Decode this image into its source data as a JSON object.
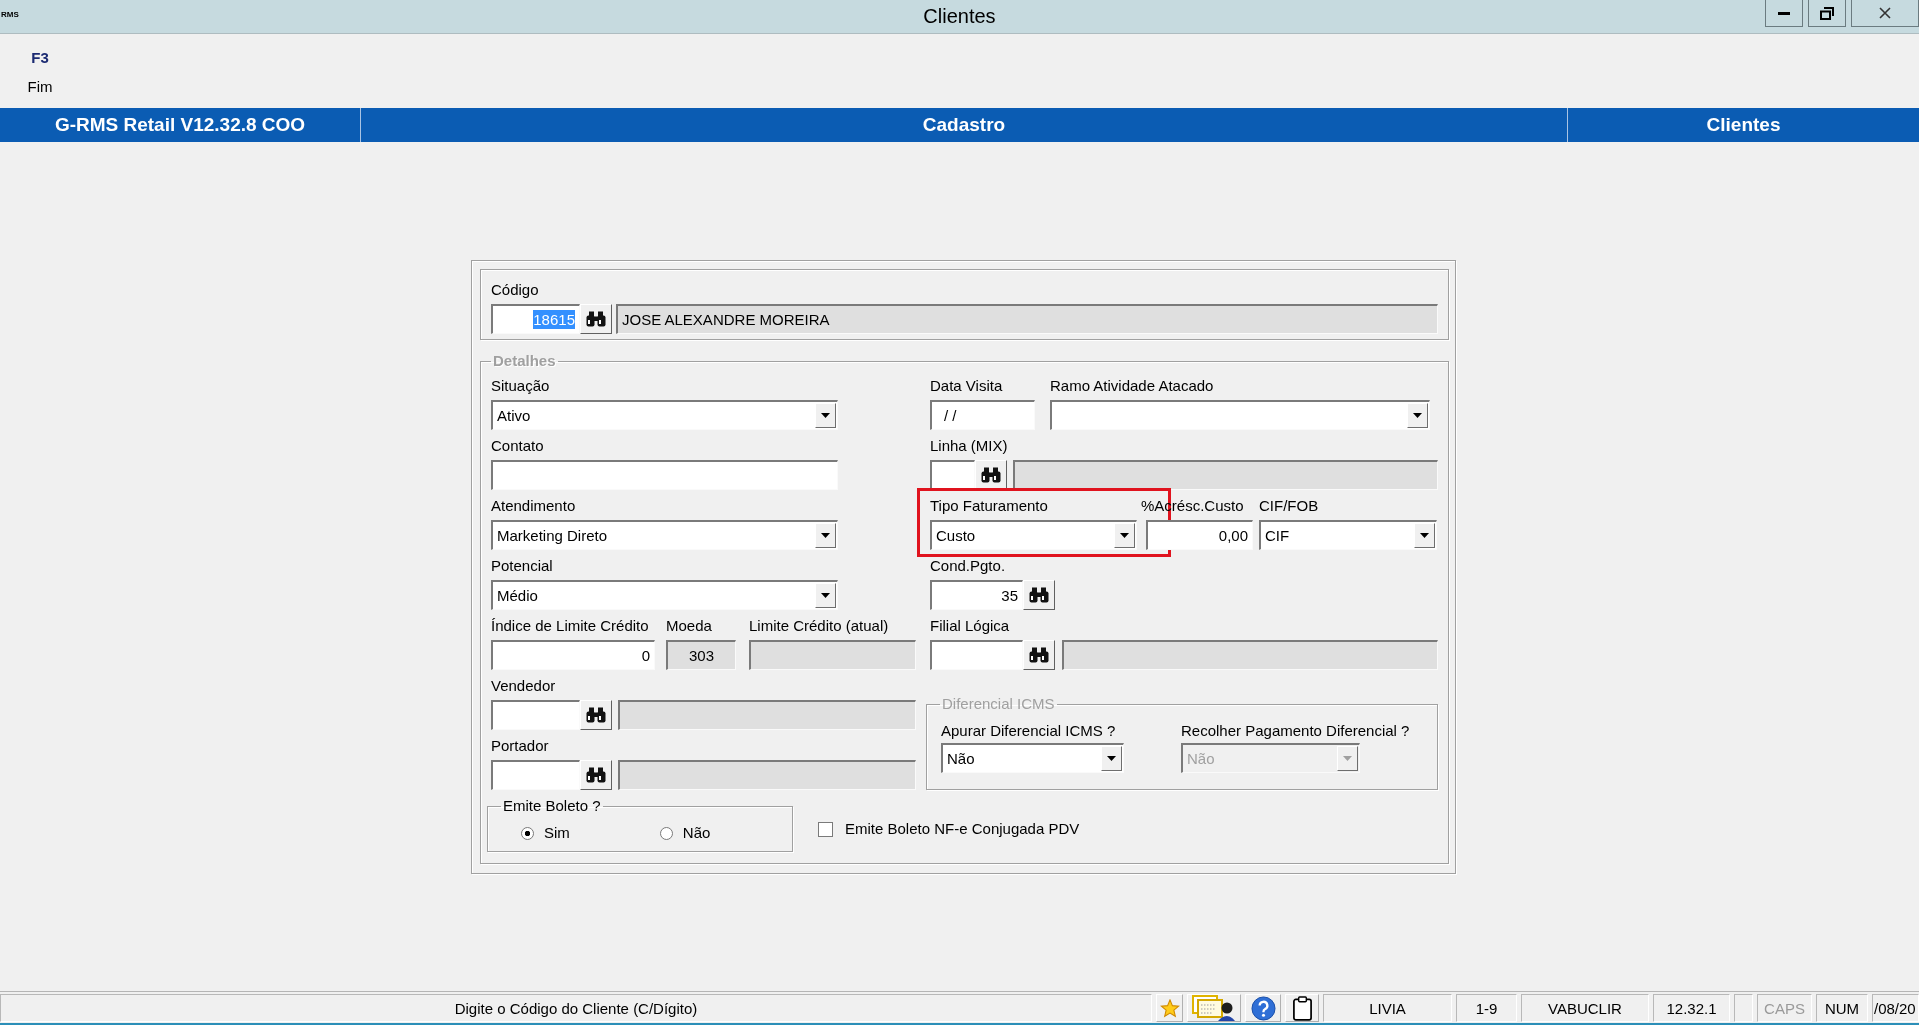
{
  "window": {
    "logo": "RMS",
    "title": "Clientes"
  },
  "toolbar": [
    {
      "key": "F3",
      "label": "Fim"
    }
  ],
  "header_bar": {
    "system": "G-RMS Retail V12.32.8 COO",
    "module": "Cadastro",
    "screen": "Clientes"
  },
  "form": {
    "codigo": {
      "label": "Código",
      "value": "18615",
      "value_selected": true,
      "name": "JOSE ALEXANDRE MOREIRA"
    },
    "details": {
      "legend": "Detalhes",
      "situacao": {
        "kind": "select",
        "label": "Situação",
        "value": "Ativo"
      },
      "data_visita": {
        "kind": "text",
        "label": "Data Visita",
        "value": "/ /"
      },
      "ramo_atividade_atacado": {
        "kind": "select",
        "label": "Ramo Atividade Atacado"
      },
      "contato": {
        "kind": "text",
        "label": "Contato"
      },
      "linha_mix": {
        "kind": "lookup",
        "label": "Linha (MIX)"
      },
      "atendimento": {
        "kind": "select",
        "label": "Atendimento",
        "value": "Marketing Direto"
      },
      "tipo_faturamento": {
        "kind": "select",
        "label": "Tipo Faturamento",
        "value": "Custo",
        "highlighted": true
      },
      "acrescimo_custo": {
        "kind": "number",
        "label": "%Acrésc.Custo",
        "value": "0,00"
      },
      "cif_fob": {
        "kind": "select",
        "label": "CIF/FOB",
        "value": "CIF"
      },
      "potencial": {
        "kind": "select",
        "label": "Potencial",
        "value": "Médio"
      },
      "cond_pgto": {
        "kind": "code_search",
        "label": "Cond.Pgto.",
        "value": "35"
      },
      "indice_limite_credito": {
        "kind": "number",
        "label": "Índice de Limite Crédito",
        "value": "0"
      },
      "moeda": {
        "kind": "readonly",
        "label": "Moeda",
        "value": "303"
      },
      "limite_credito_atual": {
        "kind": "readonly",
        "label": "Limite Crédito (atual)"
      },
      "filial_logica": {
        "kind": "lookup",
        "label": "Filial Lógica"
      },
      "vendedor": {
        "kind": "lookup",
        "label": "Vendedor"
      },
      "portador": {
        "kind": "lookup",
        "label": "Portador"
      },
      "diferencial_icms": {
        "legend": "Diferencial ICMS",
        "apurar": {
          "kind": "select",
          "label": "Apurar Diferencial ICMS ?",
          "value": "Não",
          "disabled": false
        },
        "recolher": {
          "kind": "select",
          "label": "Recolher Pagamento Diferencial ?",
          "value": "Não",
          "disabled": true
        }
      },
      "emite_boleto": {
        "legend": "Emite Boleto ?",
        "options": [
          {
            "label": "Sim",
            "selected": true
          },
          {
            "label": "Não",
            "selected": false
          }
        ]
      },
      "emite_boleto_nfe": {
        "label": "Emite Boleto NF-e Conjugada PDV",
        "checked": false
      }
    }
  },
  "status_bar": {
    "message": "Digite o Código do Cliente (C/Dígito)",
    "panels": [
      {
        "text": "LIVIA"
      },
      {
        "text": "1-9"
      },
      {
        "text": "VABUCLIR"
      },
      {
        "text": "12.32.1"
      }
    ],
    "indicators": [
      {
        "label": "CAPS",
        "on": false
      },
      {
        "label": "NUM",
        "on": true
      }
    ],
    "date": "/08/20"
  }
}
